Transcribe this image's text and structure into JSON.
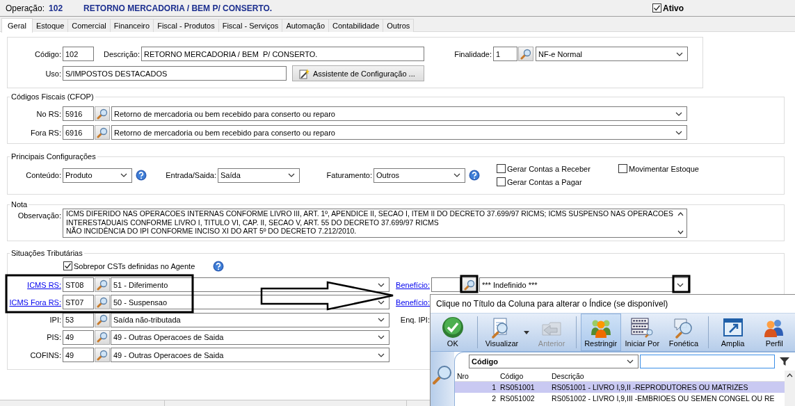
{
  "header": {
    "label": "Operação:",
    "code": "102",
    "title": "RETORNO MERCADORIA / BEM  P/ CONSERTO.",
    "active": {
      "label": "Ativo",
      "checked": true
    }
  },
  "tabs": [
    {
      "label": "Geral",
      "selected": true
    },
    {
      "label": "Estoque",
      "selected": false
    },
    {
      "label": "Comercial",
      "selected": false
    },
    {
      "label": "Financeiro",
      "selected": false
    },
    {
      "label": "Fiscal - Produtos",
      "selected": false
    },
    {
      "label": "Fiscal - Serviços",
      "selected": false
    },
    {
      "label": "Automação",
      "selected": false
    },
    {
      "label": "Contabilidade",
      "selected": false
    },
    {
      "label": "Outros",
      "selected": false
    }
  ],
  "general": {
    "codigo": {
      "label": "Código:",
      "value": "102"
    },
    "descricao": {
      "label": "Descrição:",
      "value": "RETORNO MERCADORIA / BEM  P/ CONSERTO."
    },
    "finalidade": {
      "label": "Finalidade:",
      "code": "1",
      "text": "NF-e Normal"
    },
    "uso": {
      "label": "Uso:",
      "value": "S/IMPOSTOS DESTACADOS"
    },
    "assistant_button": "Assistente de Configuração ..."
  },
  "cfop": {
    "title": "Códigos Fiscais (CFOP)",
    "rows": [
      {
        "label": "No RS:",
        "code": "5916",
        "text": "Retorno de mercadoria ou bem recebido para conserto ou reparo"
      },
      {
        "label": "Fora RS:",
        "code": "6916",
        "text": "Retorno de mercadoria ou bem recebido para conserto ou reparo"
      }
    ]
  },
  "config": {
    "title": "Principais Configurações",
    "selects": [
      {
        "label": "Conteúdo:",
        "value": "Produto",
        "help": true
      },
      {
        "label": "Entrada/Saida:",
        "value": "Saída",
        "help": false
      },
      {
        "label": "Faturamento:",
        "value": "Outros",
        "help": true
      }
    ],
    "checks": [
      {
        "label": "Gerar Contas a Receber",
        "checked": false
      },
      {
        "label": "Gerar Contas a Pagar",
        "checked": false
      },
      {
        "label": "Movimentar Estoque",
        "checked": false
      }
    ]
  },
  "nota": {
    "title": "Nota",
    "label": "Observação:",
    "lines": [
      "ICMS DIFERIDO NAS OPERACOES INTERNAS CONFORME LIVRO III, ART. 1º, APENDICE II, SECAO I, ITEM II DO DECRETO 37.699/97 RICMS; ICMS SUSPENSO NAS OPERACOES",
      "INTERESTADUAIS CONFORME LIVRO I, TITULO VI, CAP. II, SECAO V, ART. 55 DO DECRETO 37.699/97 RICMS",
      "NÃO INCIDÊNCIA DO IPI CONFORME INCISO XI DO ART 5º DO DECRETO 7.212/2010."
    ]
  },
  "situacoes": {
    "title": "Situações Tributárias",
    "override": {
      "label": "Sobrepor CSTs definidas no Agente",
      "checked": true
    },
    "rows": [
      {
        "label": "ICMS RS:",
        "kind": "link",
        "code": "ST08",
        "text": "51 - Diferimento"
      },
      {
        "label": "ICMS Fora RS:",
        "kind": "link",
        "code": "ST07",
        "text": "50 - Suspensao"
      },
      {
        "label": "IPI:",
        "kind": "plain",
        "code": "53",
        "text": "Saída não-tributada"
      },
      {
        "label": "PIS:",
        "kind": "plain",
        "code": "49",
        "text": "49 - Outras Operacoes de Saida"
      },
      {
        "label": "COFINS:",
        "kind": "plain",
        "code": "49",
        "text": "49 - Outras Operacoes de Saida"
      }
    ],
    "side": [
      {
        "label": "Benefício:",
        "kind": "link",
        "text": "*** Indefinido ***"
      },
      {
        "label": "Benefício:",
        "kind": "link"
      },
      {
        "label": "Enq. IPI:",
        "kind": "plain"
      }
    ]
  },
  "lookup": {
    "hint": "Clique no Título da Coluna para alterar o Índice (se disponível)",
    "tools": [
      {
        "label": "OK",
        "kind": "ok",
        "disabled": false,
        "selected": false
      },
      {
        "label": "Visualizar",
        "kind": "view",
        "disabled": false,
        "selected": false
      },
      {
        "label": "Anterior",
        "kind": "back",
        "disabled": true,
        "selected": false
      },
      {
        "label": "Restringir",
        "kind": "restrict",
        "disabled": false,
        "selected": true
      },
      {
        "label": "Iniciar Por",
        "kind": "startswith",
        "disabled": false,
        "selected": false
      },
      {
        "label": "Fonética",
        "kind": "phonetic",
        "disabled": false,
        "selected": false
      },
      {
        "label": "Amplia",
        "kind": "expand",
        "disabled": false,
        "selected": false
      },
      {
        "label": "Perfil",
        "kind": "profile",
        "disabled": false,
        "selected": false
      }
    ],
    "index_field": "Código",
    "columns": [
      "Nro",
      "Código",
      "Descrição"
    ],
    "rows": [
      {
        "cells": [
          "1",
          "RS051001",
          "RS051001 - LIVRO I,9,II -REPRODUTORES OU MATRIZES"
        ],
        "selected": true
      },
      {
        "cells": [
          "2",
          "RS051002",
          "RS051002 - LIVRO I,9,III -EMBRIOES OU SEMEN CONGEL OU RE"
        ],
        "selected": false
      }
    ]
  }
}
